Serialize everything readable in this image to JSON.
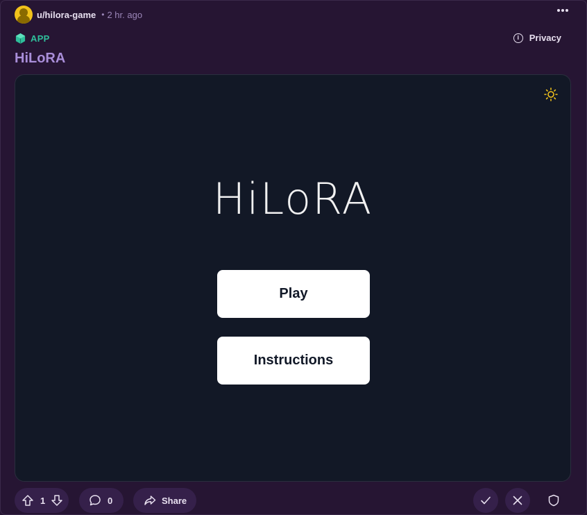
{
  "post": {
    "username": "u/hilora-game",
    "separator": "•",
    "time": "2 hr. ago",
    "app_label": "APP",
    "privacy_label": "Privacy",
    "info_glyph": "i",
    "title": "HiLoRA"
  },
  "game": {
    "title": "HiLoRA",
    "play_label": "Play",
    "instructions_label": "Instructions"
  },
  "footer": {
    "upvotes": "1",
    "comments": "0",
    "share_label": "Share"
  },
  "colors": {
    "page_bg": "#261533",
    "app_bg": "#121826",
    "title_purple": "#a98ed9",
    "app_badge_green": "#2fbf9b",
    "sun_yellow": "#f2c21b"
  },
  "icons": [
    "avatar",
    "more-icon",
    "app-icon",
    "info-icon",
    "sun-icon",
    "upvote-icon",
    "downvote-icon",
    "comment-icon",
    "share-icon",
    "approve-icon",
    "remove-icon",
    "shield-icon"
  ]
}
